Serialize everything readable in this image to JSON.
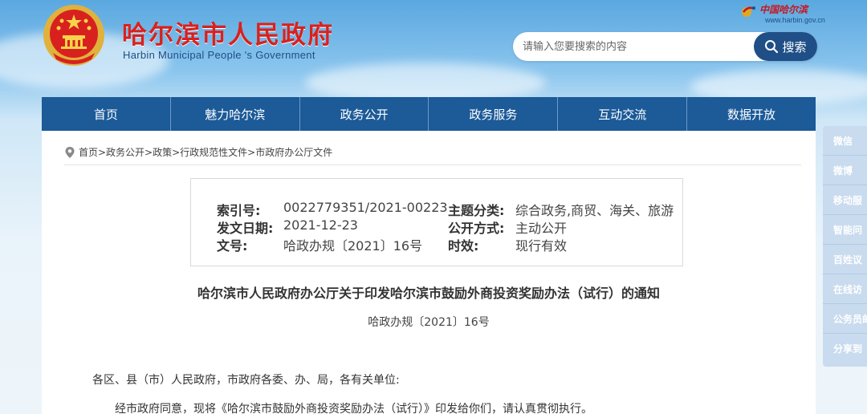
{
  "header": {
    "site_title": "哈尔滨市人民政府",
    "site_subtitle": "Harbin Municipal People 's Government",
    "brand_name": "中国哈尔滨",
    "brand_url": "www.harbin.gov.cn",
    "emblem_icon": "national-emblem-icon",
    "accent_red": "#d8211e",
    "accent_blue": "#1c5a98"
  },
  "search": {
    "placeholder": "请输入您要搜索的内容",
    "button_label": "搜索"
  },
  "nav": {
    "items": [
      {
        "label": "首页"
      },
      {
        "label": "魅力哈尔滨"
      },
      {
        "label": "政务公开"
      },
      {
        "label": "政务服务"
      },
      {
        "label": "互动交流"
      },
      {
        "label": "数据开放"
      }
    ]
  },
  "breadcrumb": {
    "text": "首页>政务公开>政策>行政规范性文件>市政府办公厅文件"
  },
  "meta": {
    "index_label": "索引号:",
    "index_value": "0022779351/2021-00223",
    "topic_label": "主题分类:",
    "topic_value": "综合政务,商贸、海关、旅游",
    "date_label": "发文日期:",
    "date_value": "2021-12-23",
    "publish_label": "公开方式:",
    "publish_value": "主动公开",
    "docno_label": "文号:",
    "docno_value": "哈政办规〔2021〕16号",
    "validity_label": "时效:",
    "validity_value": "现行有效"
  },
  "document": {
    "title": "哈尔滨市人民政府办公厅关于印发哈尔滨市鼓励外商投资奖励办法（试行）的通知",
    "number": "哈政办规〔2021〕16号",
    "salutation": "各区、县（市）人民政府，市政府各委、办、局，各有关单位:",
    "paragraph_1": "经市政府同意，现将《哈尔滨市鼓励外商投资奖励办法（试行）》印发给你们，请认真贯彻执行。"
  },
  "side_panel": {
    "items": [
      {
        "label": "微信"
      },
      {
        "label": "微博"
      },
      {
        "label": "移动服"
      },
      {
        "label": "智能问"
      },
      {
        "label": "百姓议"
      },
      {
        "label": "在线访"
      },
      {
        "label": "公务员邮"
      },
      {
        "label": "分享到"
      }
    ]
  }
}
